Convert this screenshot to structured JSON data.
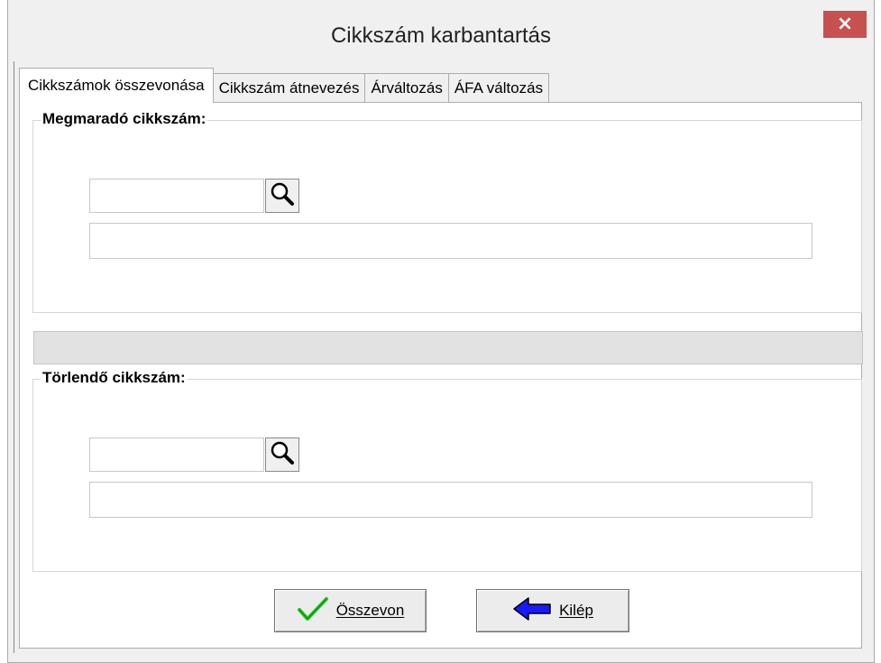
{
  "window": {
    "title": "Cikkszám karbantartás",
    "close_label": "×"
  },
  "tabs": [
    {
      "label": "Cikkszámok összevonása",
      "active": true
    },
    {
      "label": "Cikkszám átnevezés",
      "active": false
    },
    {
      "label": "Árváltozás",
      "active": false
    },
    {
      "label": "ÁFA változás",
      "active": false
    }
  ],
  "keep_group": {
    "legend": "Megmaradó cikkszám:",
    "code_value": "",
    "description_value": ""
  },
  "delete_group": {
    "legend": "Törlendő cikkszám:",
    "code_value": "",
    "description_value": ""
  },
  "progress": {
    "value": 0
  },
  "buttons": {
    "merge_label": "Összevon",
    "exit_label": "Kilép"
  },
  "icons": {
    "search": "magnifier-icon",
    "merge": "checkmark-icon",
    "exit": "left-arrow-icon",
    "checkmark_color": "#22cc22",
    "arrow_color": "#1a1aff"
  }
}
